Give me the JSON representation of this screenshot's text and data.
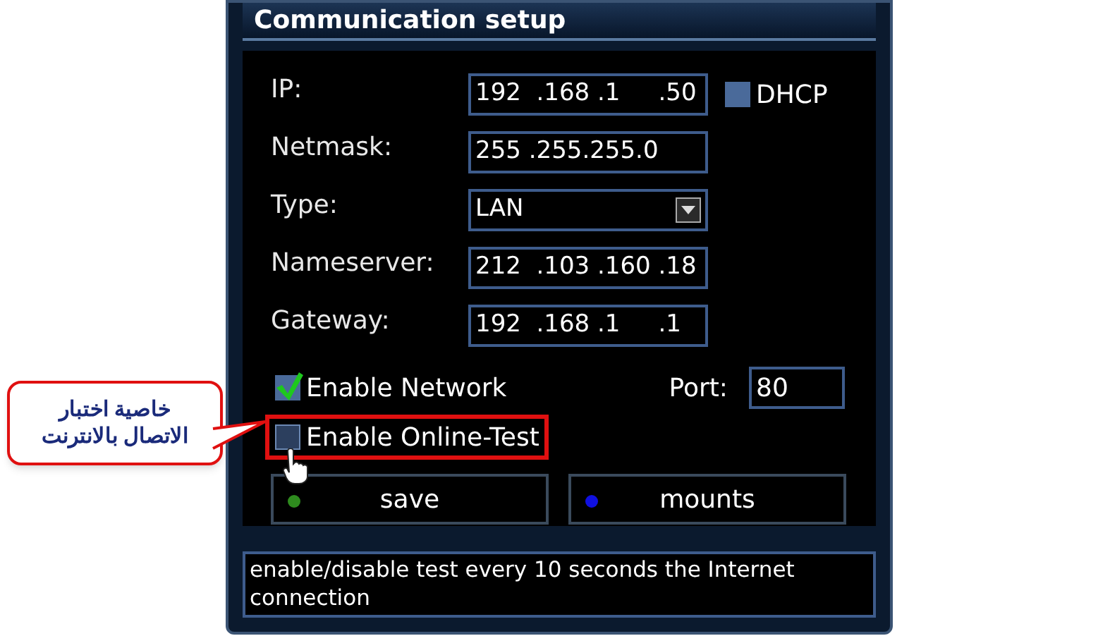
{
  "window": {
    "title": "Communication setup"
  },
  "fields": [
    {
      "label": "IP:",
      "kind": "text",
      "value": "192  .168 .1     .50"
    },
    {
      "label": "Netmask:",
      "kind": "text",
      "value": "255 .255.255.0"
    },
    {
      "label": "Type:",
      "kind": "select",
      "value": "LAN"
    },
    {
      "label": "Nameserver:",
      "kind": "text",
      "value": "212  .103 .160 .18"
    },
    {
      "label": "Gateway:",
      "kind": "text",
      "value": "192  .168 .1     .1"
    }
  ],
  "dhcp": {
    "label": "DHCP",
    "checked": false
  },
  "checkboxes": [
    {
      "label": "Enable Network",
      "checked": true,
      "highlighted": false
    },
    {
      "label": "Enable Online-Test",
      "checked": false,
      "highlighted": true
    }
  ],
  "port": {
    "label": "Port:",
    "value": "80"
  },
  "buttons": [
    {
      "label": "save",
      "color": "#2e8b1e"
    },
    {
      "label": "mounts",
      "color": "#1010e0"
    }
  ],
  "help_text": "enable/disable test every 10 seconds the Internet connection",
  "callout": {
    "text": "خاصية اختبار\nالاتصال بالانترنت"
  }
}
